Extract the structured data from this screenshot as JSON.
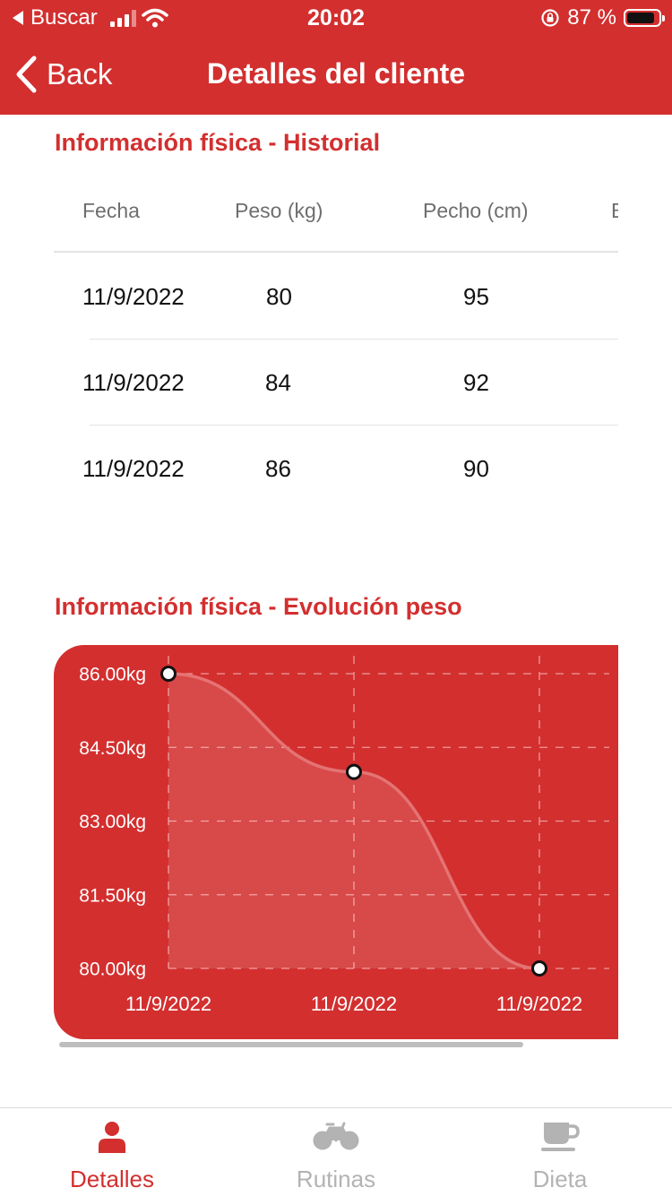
{
  "status_bar": {
    "carrier": "Buscar",
    "time": "20:02",
    "battery_percent": "87 %",
    "battery_level": 0.87
  },
  "nav": {
    "back_label": "Back",
    "title": "Detalles del cliente"
  },
  "history": {
    "title": "Información física - Historial",
    "columns": [
      "Fecha",
      "Peso (kg)",
      "Pecho (cm)",
      "B"
    ],
    "rows": [
      [
        "11/9/2022",
        "80",
        "95"
      ],
      [
        "11/9/2022",
        "84",
        "92"
      ],
      [
        "11/9/2022",
        "86",
        "90"
      ]
    ]
  },
  "evolution": {
    "title": "Información física - Evolución peso"
  },
  "chart_data": {
    "type": "line",
    "title": "",
    "xlabel": "",
    "ylabel": "",
    "categories": [
      "11/9/2022",
      "11/9/2022",
      "11/9/2022"
    ],
    "series": [
      {
        "values": [
          86,
          84,
          80
        ]
      }
    ],
    "y_ticks": [
      "86.00kg",
      "84.50kg",
      "83.00kg",
      "81.50kg",
      "80.00kg"
    ],
    "ylim": [
      80,
      86
    ],
    "grid": true,
    "curve": "smooth",
    "filled": true,
    "colors": {
      "background": "#d32f2f",
      "line": "#e57373",
      "fill": "#ffffff",
      "grid": "#ef9a9a",
      "point_fill": "#ffffff",
      "point_stroke": "#111111"
    }
  },
  "tabs": [
    {
      "label": "Detalles",
      "icon": "person-icon",
      "active": true
    },
    {
      "label": "Rutinas",
      "icon": "bicycle-icon",
      "active": false
    },
    {
      "label": "Dieta",
      "icon": "coffee-cup-icon",
      "active": false
    }
  ],
  "colors": {
    "accent": "#d32f2f",
    "tab_active": "#d32f2f",
    "tab_inactive": "#b3b3b3"
  }
}
